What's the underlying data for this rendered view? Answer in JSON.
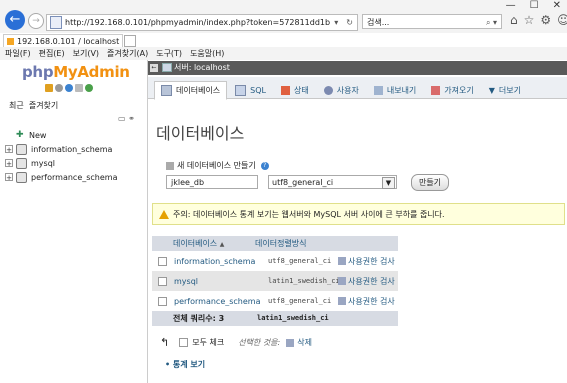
{
  "browser": {
    "url": "http://192.168.0.101/phpmyadmin/index.php?token=572811dd1b448a86253011",
    "search_placeholder": "검색...",
    "tab_title": "192.168.0.101 / localhost ...",
    "menu": [
      "파일(F)",
      "편집(E)",
      "보기(V)",
      "즐겨찾기(A)",
      "도구(T)",
      "도움말(H)"
    ]
  },
  "sidebar": {
    "logo_php": "php",
    "logo_myadmin": "MyAdmin",
    "recent": "최근",
    "favorites": "즐겨찾기",
    "new_label": "New",
    "databases": [
      "information_schema",
      "mysql",
      "performance_schema"
    ]
  },
  "server_bar": {
    "label": "서버: localhost"
  },
  "tabs": [
    {
      "label": "데이터베이스",
      "active": true
    },
    {
      "label": "SQL"
    },
    {
      "label": "상태"
    },
    {
      "label": "사용자"
    },
    {
      "label": "내보내기"
    },
    {
      "label": "가져오기"
    },
    {
      "label": "더보기"
    }
  ],
  "page_title": "데이터베이스",
  "create_db": {
    "label": "새 데이터베이스 만들기",
    "name_value": "jklee_db",
    "collation_value": "utf8_general_ci",
    "button": "만들기"
  },
  "notice": "주의: 데이터베이스 통계 보기는 웹서버와 MySQL 서버 사이에 큰 부하를 줍니다.",
  "db_table": {
    "headers": [
      "데이터베이스",
      "데이터정렬방식"
    ],
    "rows": [
      {
        "name": "information_schema",
        "collation": "utf8_general_ci",
        "action": "사용권한 검사"
      },
      {
        "name": "mysql",
        "collation": "latin1_swedish_ci",
        "action": "사용권한 검사"
      },
      {
        "name": "performance_schema",
        "collation": "utf8_general_ci",
        "action": "사용권한 검사"
      }
    ],
    "total_label": "전체 쿼리수: 3",
    "total_collation": "latin1_swedish_ci"
  },
  "bulk": {
    "check_all": "모두 체크",
    "with_selected": "선택한 것을:",
    "delete": "삭제"
  },
  "stats_link": "통계 보기",
  "colors": {
    "accent": "#235a81",
    "server_bar": "#5a5a5a",
    "notice_bg": "#ffffdd"
  }
}
